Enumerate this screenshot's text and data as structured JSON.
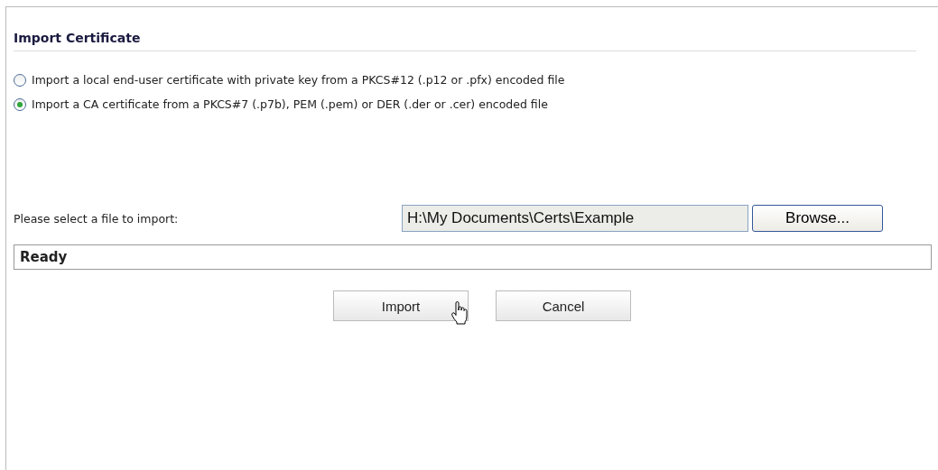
{
  "title": "Import Certificate",
  "options": [
    {
      "label": "Import a local end-user certificate with private key from a PKCS#12 (.p12 or .pfx) encoded file",
      "selected": false
    },
    {
      "label": "Import a CA certificate from a PKCS#7 (.p7b), PEM (.pem) or DER (.der or .cer) encoded file",
      "selected": true
    }
  ],
  "file": {
    "label": "Please select a file to import:",
    "value": "H:\\My Documents\\Certs\\Example",
    "browse": "Browse..."
  },
  "status": "Ready",
  "buttons": [
    "Import",
    "Cancel"
  ]
}
